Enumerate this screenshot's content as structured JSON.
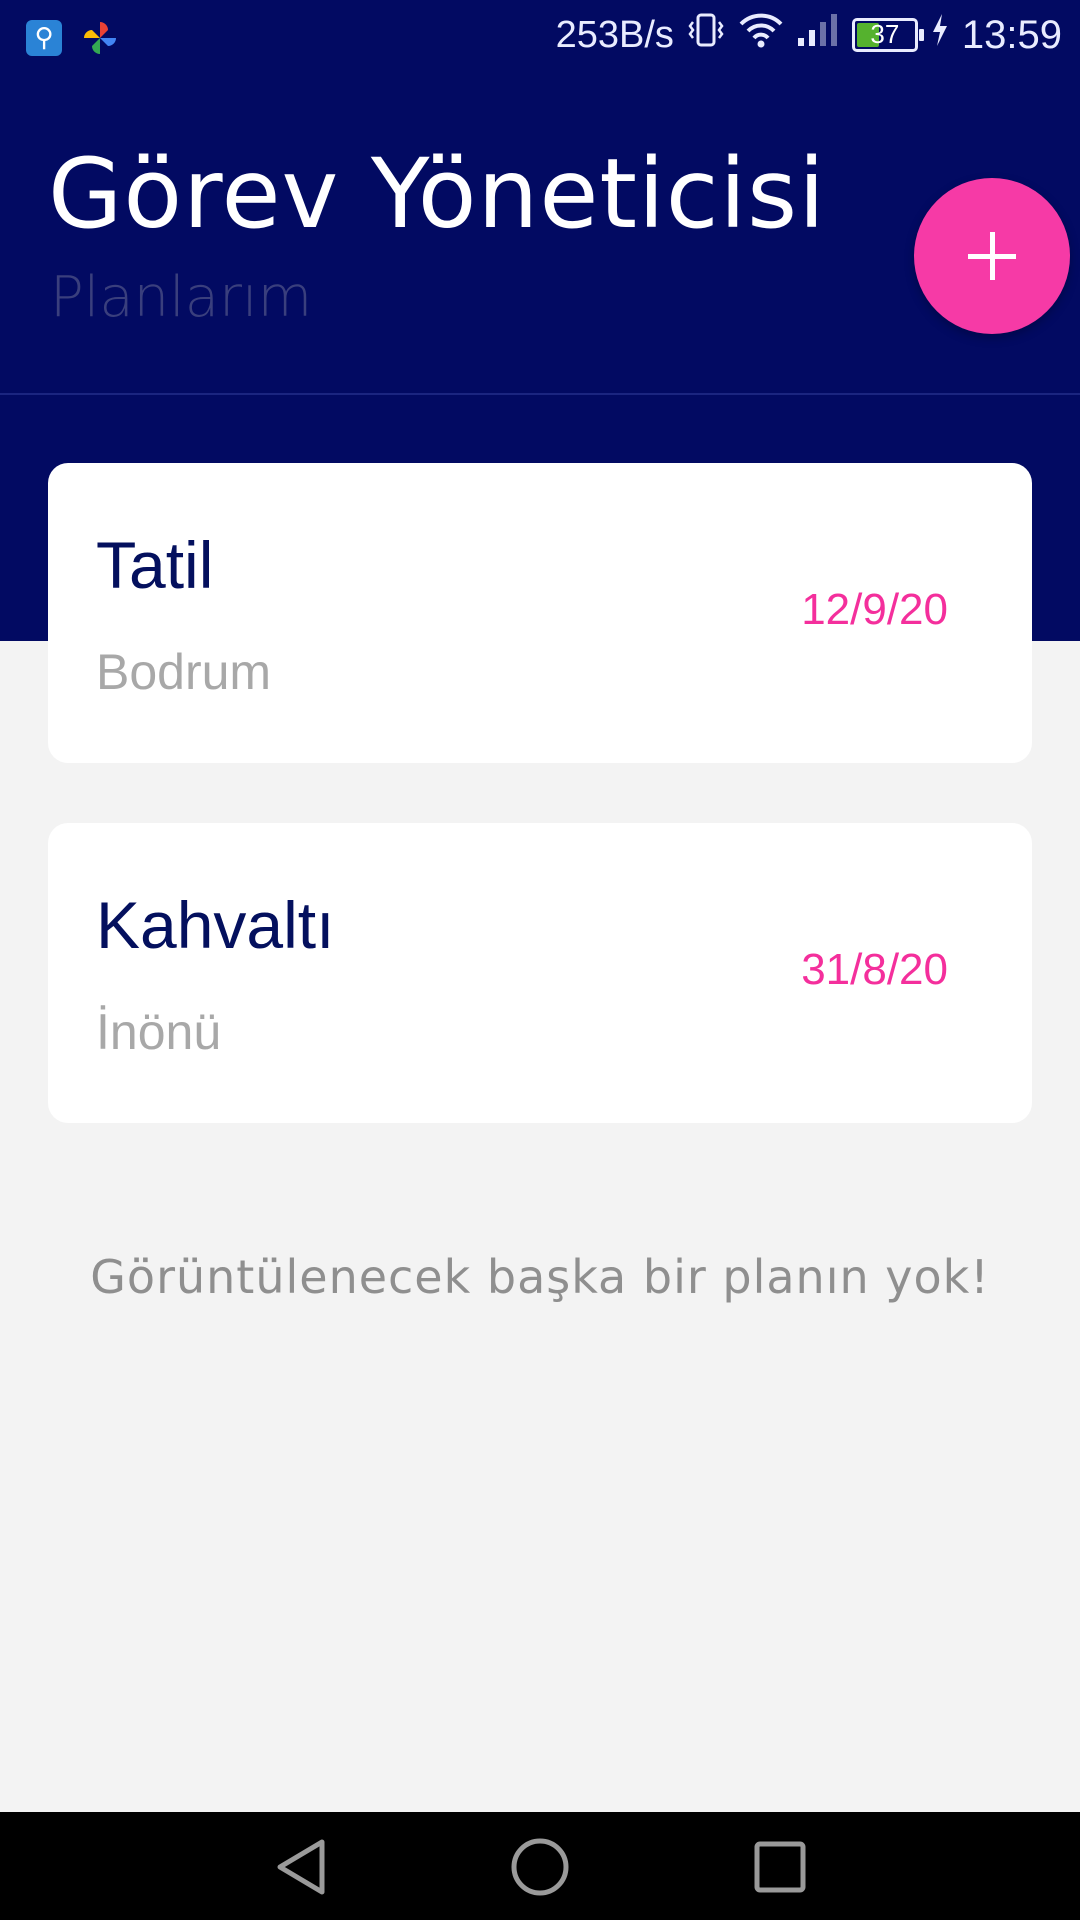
{
  "status_bar": {
    "net_speed": "253B/s",
    "battery_percent": "37",
    "battery_level": 0.37,
    "time": "13:59",
    "icons": [
      "usb-icon",
      "pinwheel-icon",
      "vibrate-icon",
      "wifi-icon",
      "signal-icon",
      "battery-icon",
      "charging-icon"
    ]
  },
  "header": {
    "title": "Görev Yöneticisi",
    "subtitle": "Planlarım"
  },
  "fab": {
    "icon": "plus-icon",
    "color": "#f63aa6"
  },
  "plans": [
    {
      "title": "Tatil",
      "location": "Bodrum",
      "date": "12/9/20"
    },
    {
      "title": "Kahvaltı",
      "location": "İnönü",
      "date": "31/8/20"
    }
  ],
  "empty_message": "Görüntülenecek başka bir planın yok!",
  "nav_bar": {
    "icons": [
      "back-icon",
      "home-icon",
      "recents-icon"
    ]
  },
  "colors": {
    "header_bg": "#020a62",
    "accent": "#f42f9c",
    "title_text": "#04105e"
  }
}
